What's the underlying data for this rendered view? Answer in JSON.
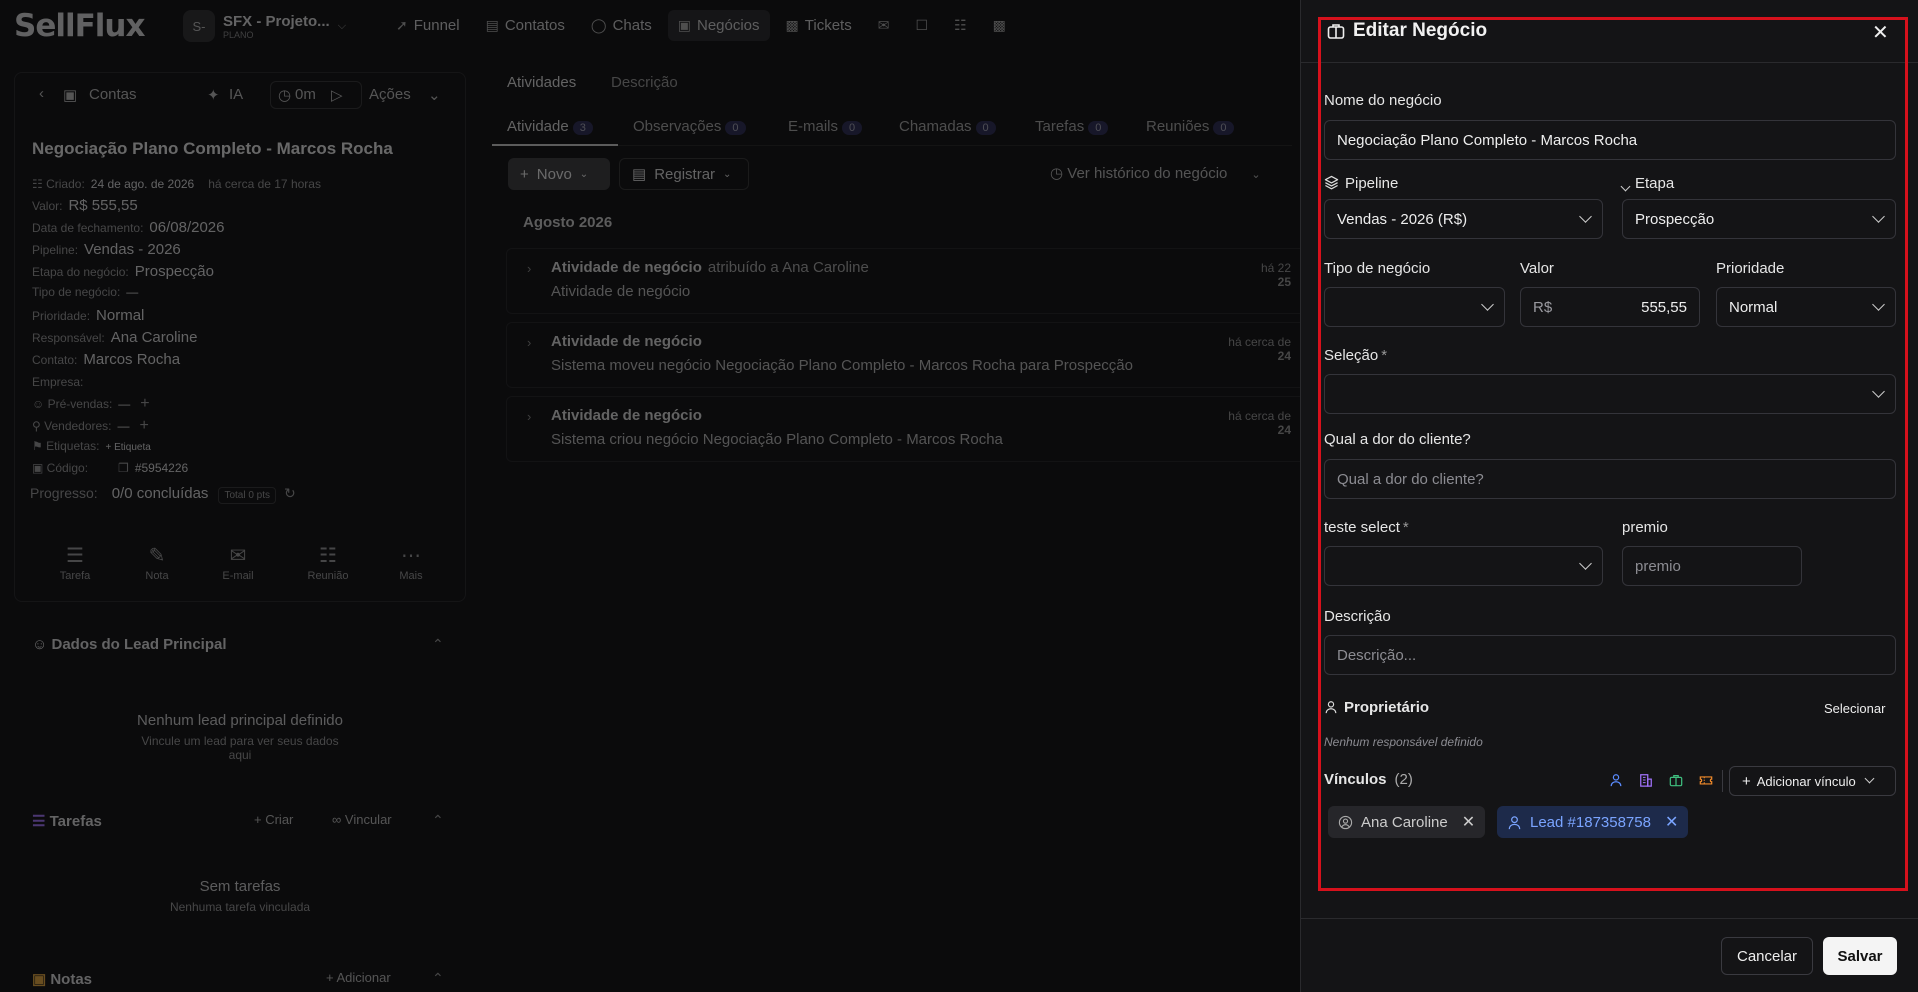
{
  "app": {
    "logo": "SellFlux",
    "project": {
      "avatar": "S-",
      "name": "SFX - Projeto...",
      "plan": "PLANO"
    },
    "nav": [
      "Funnel",
      "Contatos",
      "Chats",
      "Negócios",
      "Tickets"
    ]
  },
  "deal": {
    "back_label": "Contas",
    "ia_label": "IA",
    "timer": "0m",
    "actions_label": "Ações",
    "title": "Negociação Plano Completo - Marcos Rocha",
    "fields": [
      {
        "k": "Criado:",
        "v": "24 de ago. de 2026",
        "extra": "há cerca de 17 horas"
      },
      {
        "k": "Valor:",
        "v": "R$ 555,55"
      },
      {
        "k": "Data de fechamento:",
        "v": "06/08/2026"
      },
      {
        "k": "Pipeline:",
        "v": "Vendas - 2026"
      },
      {
        "k": "Etapa do negócio:",
        "v": "Prospecção"
      },
      {
        "k": "Tipo de negócio:",
        "v": "—"
      },
      {
        "k": "Prioridade:",
        "v": "Normal"
      },
      {
        "k": "Responsável:",
        "v": "Ana Caroline"
      },
      {
        "k": "Contato:",
        "v": "Marcos Rocha"
      },
      {
        "k": "Empresa:",
        "v": ""
      },
      {
        "k": "Pré-vendas:",
        "v": "—"
      },
      {
        "k": "Vendedores:",
        "v": "—"
      },
      {
        "k": "Etiquetas:",
        "v": "+ Etiqueta"
      },
      {
        "k": "Código:",
        "v": "#5954226"
      }
    ],
    "progress_label": "Progresso:",
    "progress_value": "0/0 concluídas",
    "progress_pts": "Total 0 pts",
    "quick_actions": [
      "Tarefa",
      "Nota",
      "E-mail",
      "Reunião",
      "Mais"
    ],
    "lead_section": {
      "title": "Dados do Lead Principal",
      "empty": "Nenhum lead principal definido",
      "hint": "Vincule um lead para ver seus dados aqui"
    },
    "tasks_section": {
      "title": "Tarefas",
      "create": "Criar",
      "link": "Vincular",
      "empty": "Sem tarefas",
      "hint": "Nenhuma tarefa vinculada"
    },
    "notes_section": {
      "title": "Notas",
      "add": "Adicionar"
    }
  },
  "activity": {
    "top_tabs": [
      "Atividades",
      "Descrição"
    ],
    "tabs": [
      {
        "label": "Atividade",
        "count": "3"
      },
      {
        "label": "Observações",
        "count": "0"
      },
      {
        "label": "E-mails",
        "count": "0"
      },
      {
        "label": "Chamadas",
        "count": "0"
      },
      {
        "label": "Tarefas",
        "count": "0"
      },
      {
        "label": "Reuniões",
        "count": "0"
      }
    ],
    "new_label": "Novo",
    "register_label": "Registrar",
    "history_label": "Ver histórico do negócio",
    "month": "Agosto 2026",
    "items": [
      {
        "title": "Atividade de negócio",
        "meta": "atribuído a Ana Caroline",
        "desc": "Atividade de negócio",
        "time1": "há 22",
        "time2": "25"
      },
      {
        "title": "Atividade de negócio",
        "meta": "",
        "desc": "Sistema moveu negócio Negociação Plano Completo - Marcos Rocha para Prospecção",
        "time1": "há cerca de",
        "time2": "24"
      },
      {
        "title": "Atividade de negócio",
        "meta": "",
        "desc": "Sistema criou negócio Negociação Plano Completo - Marcos Rocha",
        "time1": "há cerca de",
        "time2": "24"
      }
    ]
  },
  "drawer": {
    "title": "Editar Negócio",
    "name_label": "Nome do negócio",
    "name_value": "Negociação Plano Completo - Marcos Rocha",
    "pipeline_label": "Pipeline",
    "pipeline_value": "Vendas - 2026 (R$)",
    "stage_label": "Etapa",
    "stage_value": "Prospecção",
    "type_label": "Tipo de negócio",
    "type_value": "",
    "value_label": "Valor",
    "value_currency": "R$",
    "value_amount": "555,55",
    "priority_label": "Prioridade",
    "priority_value": "Normal",
    "selection_label": "Seleção",
    "required_mark": "*",
    "pain_label": "Qual a dor do cliente?",
    "pain_placeholder": "Qual a dor do cliente?",
    "test_select_label": "teste select",
    "prize_label": "premio",
    "prize_placeholder": "premio",
    "desc_label": "Descrição",
    "desc_placeholder": "Descrição...",
    "owner_label": "Proprietário",
    "owner_select": "Selecionar",
    "owner_empty": "Nenhum responsável definido",
    "links_label": "Vínculos",
    "links_count": "(2)",
    "add_link_label": "Adicionar vínculo",
    "chips": [
      {
        "label": "Ana Caroline",
        "kind": "user"
      },
      {
        "label": "Lead #187358758",
        "kind": "lead"
      }
    ],
    "cancel_label": "Cancelar",
    "save_label": "Salvar"
  },
  "colors": {
    "accent_blue": "#5b8cff",
    "purple": "#a374ff",
    "green": "#3fbf7f",
    "orange": "#f08a2a",
    "highlight": "#d6111c"
  }
}
